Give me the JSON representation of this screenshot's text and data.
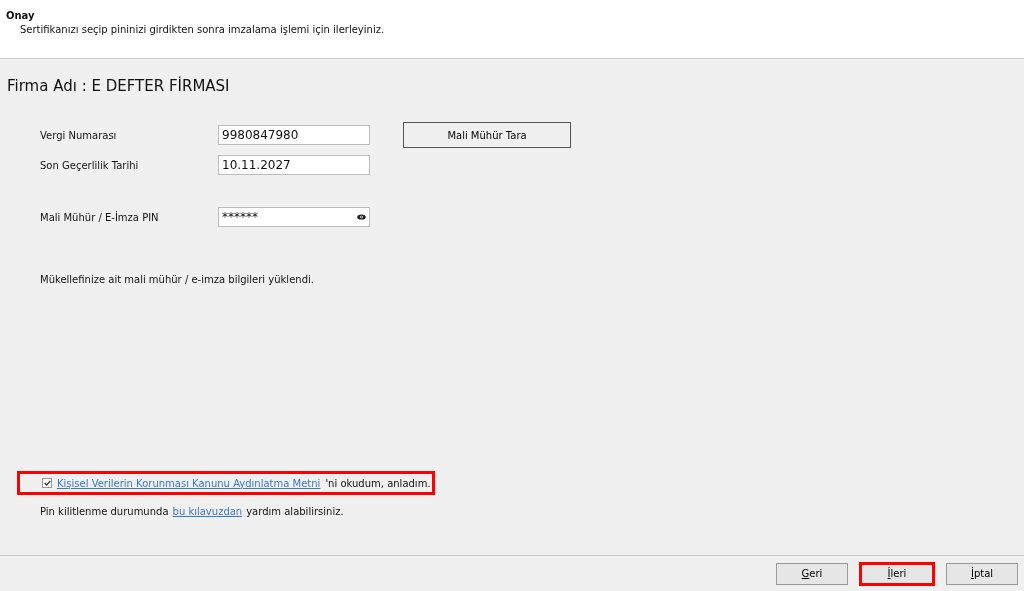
{
  "header": {
    "title": "Onay",
    "subtitle": "Sertifikanızı seçip pininizi girdikten sonra imzalama işlemi için ilerleyiniz."
  },
  "company": "Firma Adı : E DEFTER FİRMASI",
  "fields": [
    {
      "kind": "text",
      "label": "Vergi Numarası",
      "value": "9980847980"
    },
    {
      "kind": "text",
      "label": "Son Geçerlilik Tarihi",
      "value": "10.11.2027"
    },
    {
      "kind": "password",
      "label": "Mali Mühür / E-İmza PIN",
      "value": "******"
    }
  ],
  "scan_button": "Mali Mühür Tara",
  "status_message": "Mükellefinize ait mali mühür / e-imza bilgileri yüklendi.",
  "consent": {
    "checked": true,
    "highlighted": true,
    "link": "Kişisel Verilerin Korunması Kanunu Aydınlatma Metni",
    "text": "'ni okudum, anladım."
  },
  "help": {
    "before": "Pin kilitlenme durumunda",
    "link": "bu kılavuzdan",
    "after": "yardım alabilirsiniz."
  },
  "buttons": [
    {
      "label": "Geri",
      "highlighted": false,
      "mnemonic": true
    },
    {
      "label": "İleri",
      "highlighted": true,
      "mnemonic": true
    },
    {
      "label": "İptal",
      "highlighted": false,
      "mnemonic": true
    }
  ]
}
